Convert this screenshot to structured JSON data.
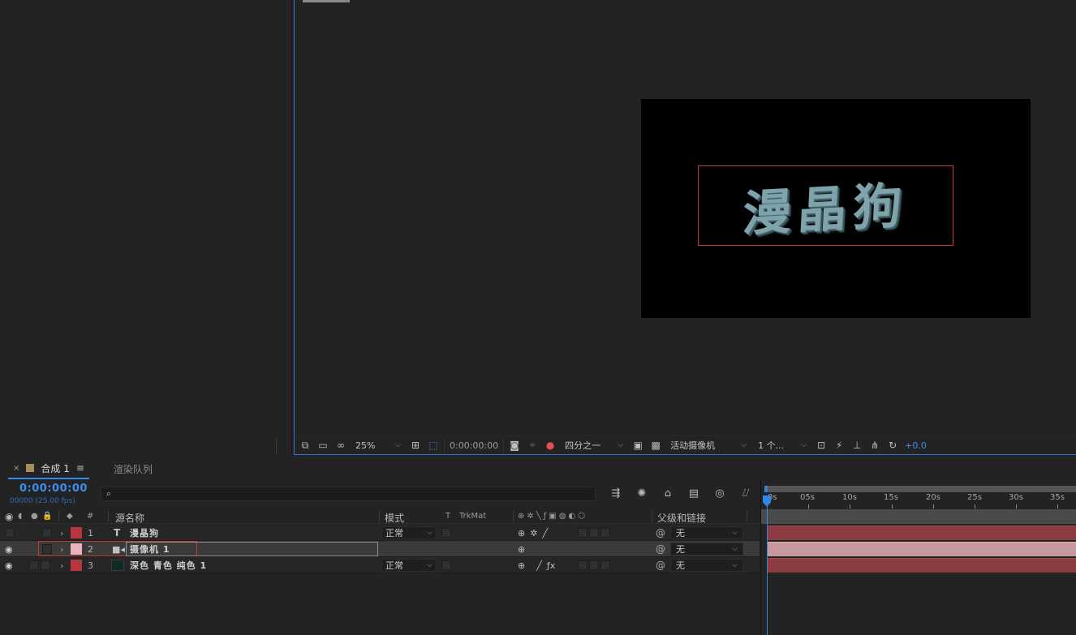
{
  "viewer": {
    "comp_text": "漫晶狗",
    "toolbar": {
      "zoom": "25%",
      "timecode": "0:00:00:00",
      "resolution": "四分之一",
      "camera": "活动摄像机",
      "views": "1 个...",
      "exposure": "+0.0"
    }
  },
  "timeline": {
    "tabs": [
      {
        "label": "合成 1",
        "active": true,
        "menu": "≡",
        "close": "×"
      },
      {
        "label": "渲染队列",
        "active": false
      }
    ],
    "current_time": "0:00:00:00",
    "frame_info": "00000 (25.00 fps)",
    "search_icon": "⌕",
    "columns": {
      "number": "#",
      "source_name": "源名称",
      "mode": "模式",
      "t": "T",
      "trkmat": "TrkMat",
      "parent": "父级和链接"
    },
    "layers": [
      {
        "index": "1",
        "type_icon": "T",
        "name": "漫晶狗",
        "label_color": "#b8373c",
        "mode": "正常",
        "parent": "无",
        "selected": false
      },
      {
        "index": "2",
        "type_icon": "camera-icon",
        "name": "摄像机 1",
        "label_color": "#e8b5bf",
        "mode": "",
        "parent": "无",
        "selected": true
      },
      {
        "index": "3",
        "type_icon": "solid-icon",
        "name": "深色 青色 纯色 1",
        "label_color": "#b8373c",
        "mode": "正常",
        "parent": "无",
        "selected": false
      }
    ],
    "ruler": [
      "0s",
      "05s",
      "10s",
      "15s",
      "20s",
      "25s",
      "30s",
      "35s"
    ]
  },
  "colors": {
    "accent_blue": "#2f86e6",
    "selection_red": "#c8393a",
    "layer_bar_red": "#8a3c41",
    "layer_bar_pink": "#c7999f"
  }
}
